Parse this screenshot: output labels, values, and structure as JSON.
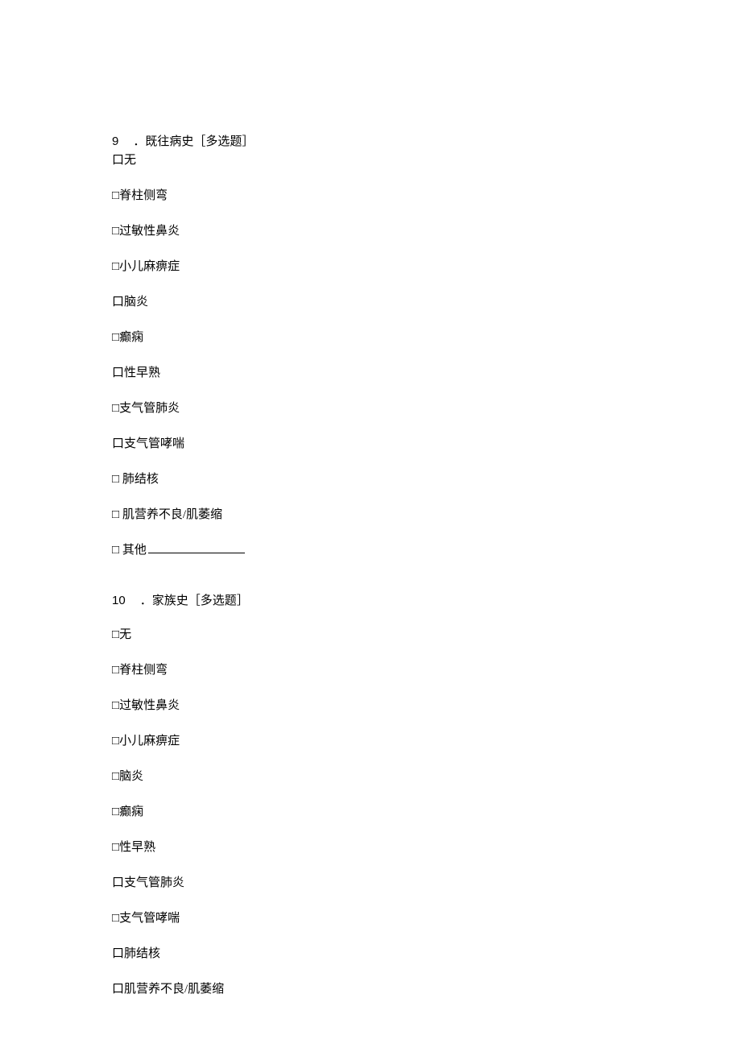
{
  "q9": {
    "number": "9",
    "title": "．既往病史［多选题］",
    "options": [
      {
        "box": "口",
        "text": "无"
      },
      {
        "box": "□",
        "text": "脊柱侧弯"
      },
      {
        "box": "□",
        "text": "过敏性鼻炎"
      },
      {
        "box": "□",
        "text": "小儿麻痹症"
      },
      {
        "box": "口",
        "text": "脑炎"
      },
      {
        "box": "□",
        "text": "癫痫"
      },
      {
        "box": "口",
        "text": "性早熟"
      },
      {
        "box": "□",
        "text": "支气管肺炎"
      },
      {
        "box": "口",
        "text": "支气管哮喘"
      },
      {
        "box": "□",
        "text": " 肺结核"
      },
      {
        "box": "□",
        "text": " 肌营养不良/肌萎缩"
      }
    ],
    "other_box": "□",
    "other_text": " 其他"
  },
  "q10": {
    "number": "10",
    "title": "．家族史［多选题］",
    "options": [
      {
        "box": "□",
        "text": "无"
      },
      {
        "box": "□",
        "text": "脊柱侧弯"
      },
      {
        "box": "□",
        "text": "过敏性鼻炎"
      },
      {
        "box": "□",
        "text": "小儿麻痹症"
      },
      {
        "box": "□",
        "text": "脑炎"
      },
      {
        "box": "□",
        "text": "癫痫"
      },
      {
        "box": "□",
        "text": "性早熟"
      },
      {
        "box": "口",
        "text": "支气管肺炎"
      },
      {
        "box": "□",
        "text": "支气管哮喘"
      },
      {
        "box": "口",
        "text": "肺结核"
      },
      {
        "box": "口",
        "text": "肌营养不良/肌萎缩"
      }
    ]
  }
}
